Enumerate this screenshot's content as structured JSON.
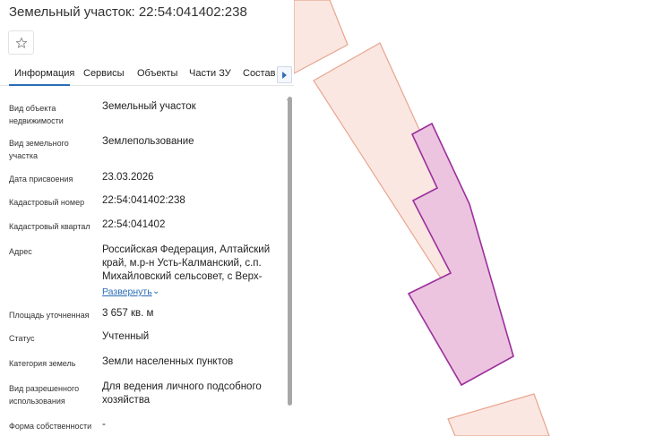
{
  "panel": {
    "title": "Земельный участок: 22:54:041402:238",
    "tabs": [
      "Информация",
      "Сервисы",
      "Объекты",
      "Части ЗУ",
      "Состав"
    ],
    "active_tab": 0,
    "icons": {
      "favorite": "star-icon",
      "tabs_next": "chevron-right-icon",
      "expand": "chevron-down-icon"
    },
    "expand_label": "Развернуть",
    "rows": [
      {
        "label": "Вид объекта недвижимости",
        "value": "Земельный участок"
      },
      {
        "label": "Вид земельного участка",
        "value": "Землепользование"
      },
      {
        "label": "Дата присвоения",
        "value": "23.03.2026"
      },
      {
        "label": "Кадастровый номер",
        "value": "22:54:041402:238"
      },
      {
        "label": "Кадастровый квартал",
        "value": "22:54:041402"
      },
      {
        "label": "Адрес",
        "value": "Российская Федерация, Алтайский край, м.р-н Усть-Калманский, с.п. Михайловский сельсовет, с Верх-"
      },
      {
        "label": "Площадь уточненная",
        "value": "3 657 кв. м"
      },
      {
        "label": "Статус",
        "value": "Учтенный"
      },
      {
        "label": "Категория земель",
        "value": "Земли населенных пунктов"
      },
      {
        "label": "Вид разрешенного использования",
        "value": "Для ведения личного подсобного хозяйства"
      },
      {
        "label": "Форма собственности",
        "value": "-"
      }
    ]
  },
  "map": {
    "colors": {
      "parcel_fill": "#fbe7e1",
      "parcel_stroke": "#e8a58f",
      "selected_fill": "#ecc4e0",
      "selected_stroke": "#9b2f9c",
      "accent": "#2a6db5"
    }
  }
}
